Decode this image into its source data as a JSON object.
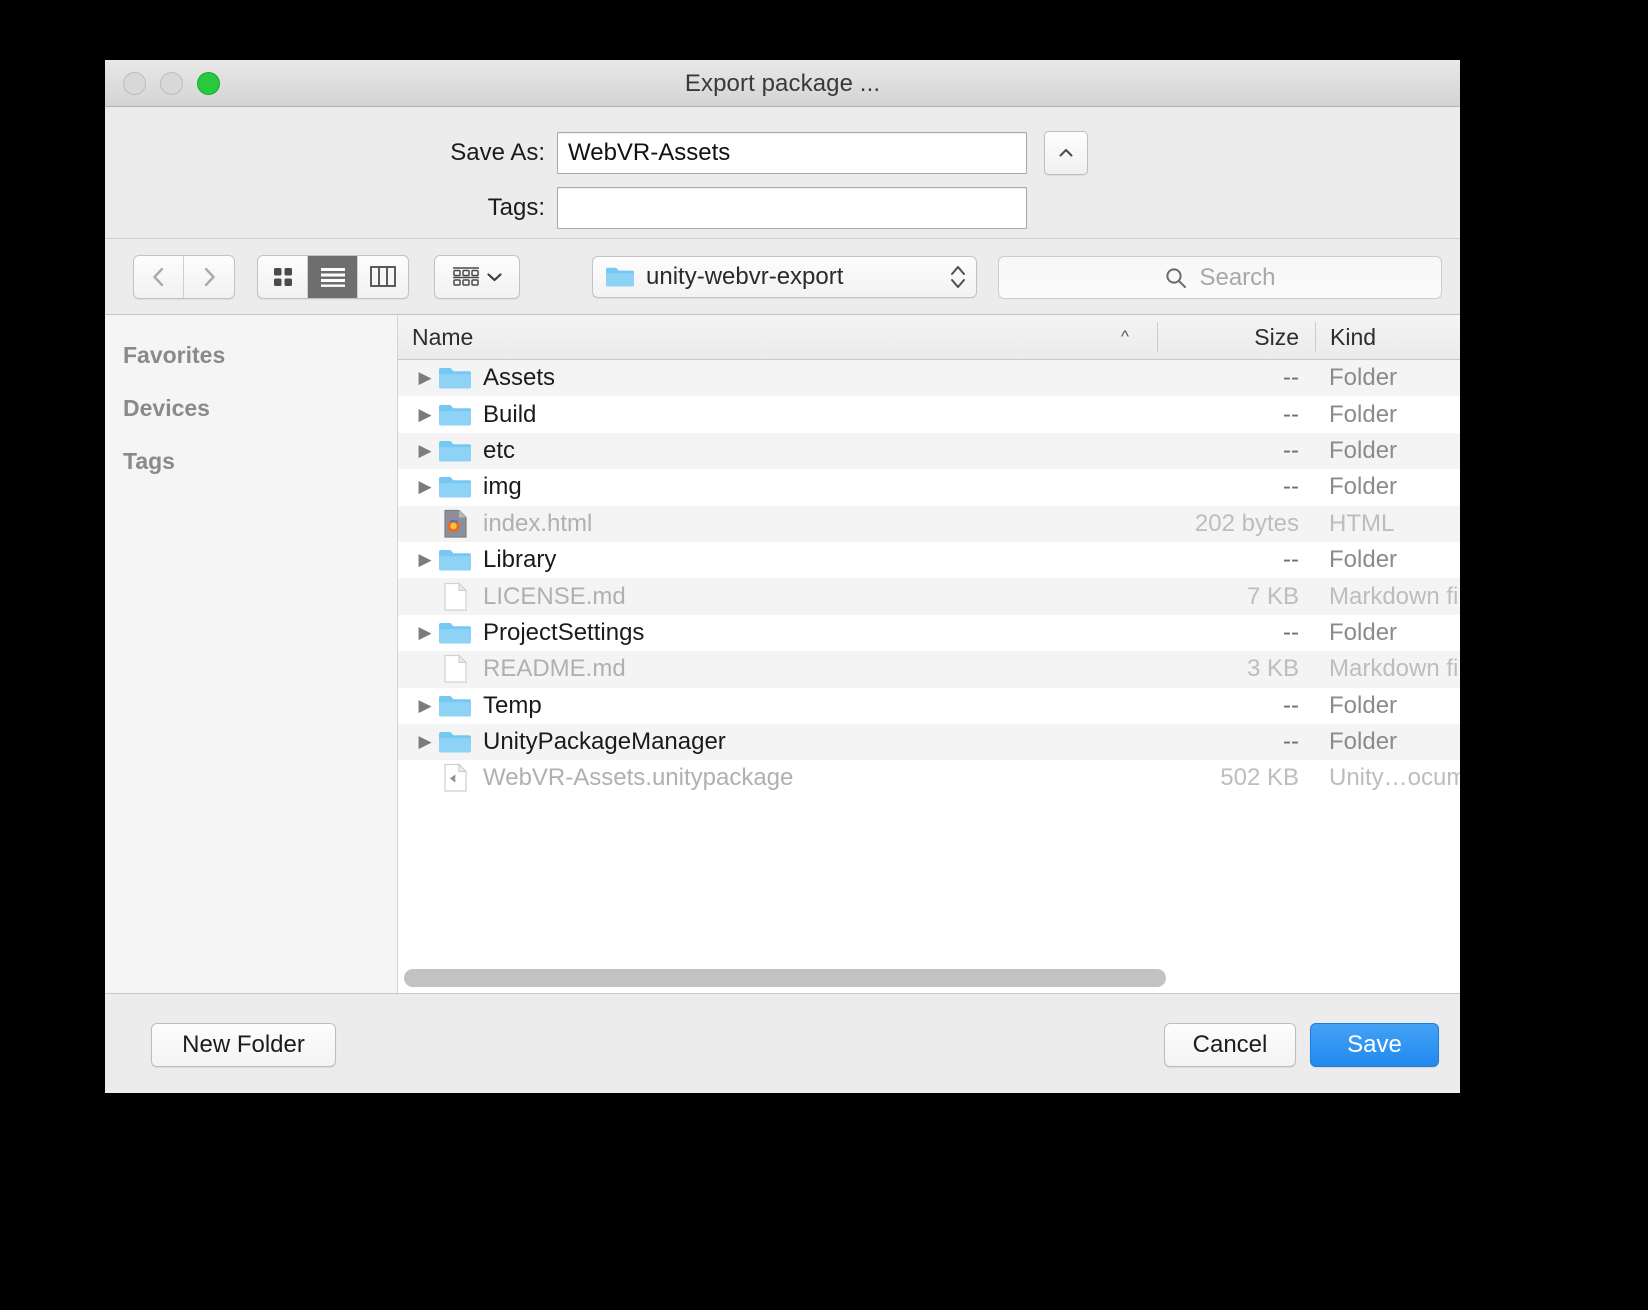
{
  "window": {
    "title": "Export package ...",
    "traffic_lights": [
      "close-button",
      "minimize-button",
      "zoom-button"
    ]
  },
  "form": {
    "save_as_label": "Save As:",
    "save_as_value": "WebVR-Assets",
    "tags_label": "Tags:",
    "tags_value": "",
    "tags_placeholder": "",
    "disclosure_icon": "chevron-up-icon"
  },
  "toolbar": {
    "back_icon": "chevron-left-icon",
    "forward_icon": "chevron-right-icon",
    "view_icon_grid": "icon-view-icon",
    "view_list": "list-view-icon",
    "view_columns": "column-view-icon",
    "active_view": "list-view-icon",
    "arrange_icon": "arrange-by-icon",
    "arrange_chevron": "chevron-down-icon",
    "path_label": "unity-webvr-export",
    "path_folder_icon": "folder-icon",
    "path_stepper_icon": "up-down-stepper-icon",
    "search_icon": "search-icon",
    "search_placeholder": "Search",
    "search_value": ""
  },
  "sidebar": {
    "sections": [
      {
        "label": "Favorites"
      },
      {
        "label": "Devices"
      },
      {
        "label": "Tags"
      }
    ]
  },
  "filelist": {
    "columns": {
      "name": "Name",
      "size": "Size",
      "kind": "Kind",
      "sort_caret": "caret-up-icon",
      "sort_column": "Name",
      "sort_direction": "ascending"
    },
    "rows": [
      {
        "name": "Assets",
        "size": "--",
        "kind": "Folder",
        "icon": "folder-icon",
        "expandable": true,
        "enabled": true
      },
      {
        "name": "Build",
        "size": "--",
        "kind": "Folder",
        "icon": "folder-icon",
        "expandable": true,
        "enabled": true
      },
      {
        "name": "etc",
        "size": "--",
        "kind": "Folder",
        "icon": "folder-icon",
        "expandable": true,
        "enabled": true
      },
      {
        "name": "img",
        "size": "--",
        "kind": "Folder",
        "icon": "folder-icon",
        "expandable": true,
        "enabled": true
      },
      {
        "name": "index.html",
        "size": "202 bytes",
        "kind": "HTML",
        "icon": "firefox-document-icon",
        "expandable": false,
        "enabled": false
      },
      {
        "name": "Library",
        "size": "--",
        "kind": "Folder",
        "icon": "folder-icon",
        "expandable": true,
        "enabled": true
      },
      {
        "name": "LICENSE.md",
        "size": "7 KB",
        "kind": "Markdown fil",
        "icon": "document-icon",
        "expandable": false,
        "enabled": false
      },
      {
        "name": "ProjectSettings",
        "size": "--",
        "kind": "Folder",
        "icon": "folder-icon",
        "expandable": true,
        "enabled": true
      },
      {
        "name": "README.md",
        "size": "3 KB",
        "kind": "Markdown fil",
        "icon": "document-icon",
        "expandable": false,
        "enabled": false
      },
      {
        "name": "Temp",
        "size": "--",
        "kind": "Folder",
        "icon": "folder-icon",
        "expandable": true,
        "enabled": true
      },
      {
        "name": "UnityPackageManager",
        "size": "--",
        "kind": "Folder",
        "icon": "folder-icon",
        "expandable": true,
        "enabled": true
      },
      {
        "name": "WebVR-Assets.unitypackage",
        "size": "502 KB",
        "kind": "Unity…ocume",
        "icon": "unity-document-icon",
        "expandable": false,
        "enabled": false
      }
    ]
  },
  "footer": {
    "new_folder_label": "New Folder",
    "cancel_label": "Cancel",
    "save_label": "Save"
  },
  "colors": {
    "accent": "#2289ef",
    "folder_blue": "#6fc9f5",
    "zoom_green": "#28c93f",
    "window_chrome": "#ececec"
  }
}
